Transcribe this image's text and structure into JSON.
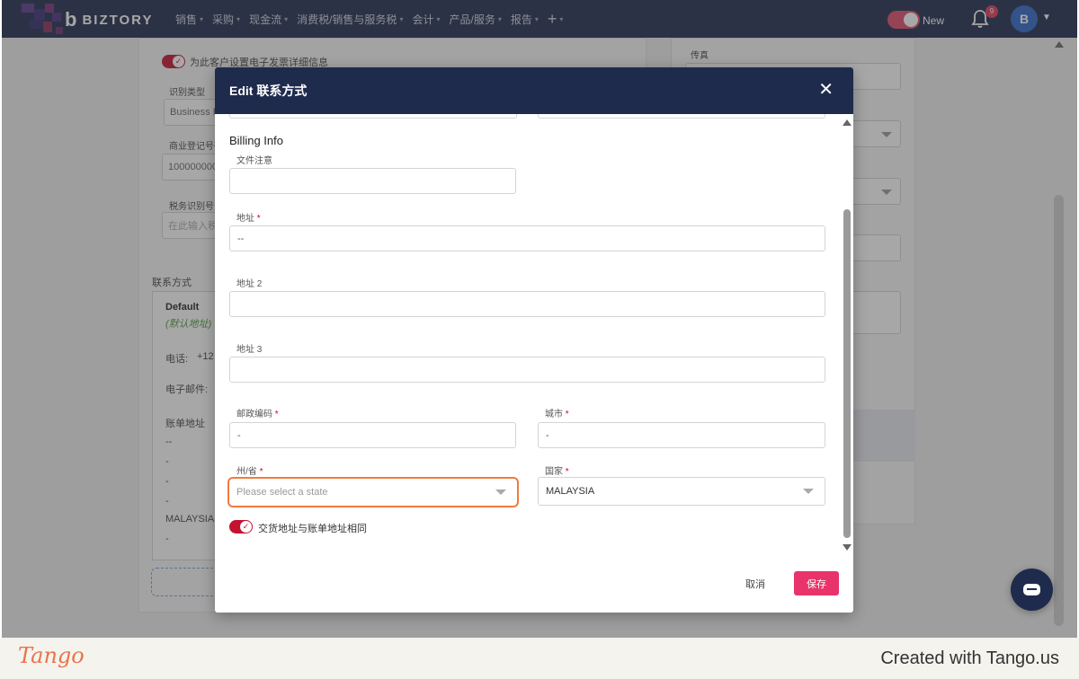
{
  "topnav": {
    "logo_text": "BIZTORY",
    "logo_mark": "b",
    "menu": [
      {
        "label": "销售"
      },
      {
        "label": "采购"
      },
      {
        "label": "现金流"
      },
      {
        "label": "消费税/销售与服务税"
      },
      {
        "label": "会计"
      },
      {
        "label": "产品/服务"
      },
      {
        "label": "报告"
      }
    ],
    "plus_label": "+",
    "new_label": "New",
    "notification_count": "9",
    "avatar_letter": "B",
    "brand_color": "#1f2b4d"
  },
  "background": {
    "einvoice_toggle_label": "为此客户设置电子发票详细信息",
    "id_type_label": "识别类型",
    "id_type_value": "Business R",
    "brn_label": "商业登记号码",
    "brn_value": "100000000",
    "tin_label": "税务识别号",
    "tin_placeholder": "在此输入税",
    "contacts_label": "联系方式",
    "contact_default": "Default",
    "contact_default_sub": "(默认地址)",
    "phone_label": "电话:",
    "phone_value": "+12",
    "email_label": "电子邮件:",
    "billing_label": "账单地址",
    "billing_lines": [
      "--",
      "-",
      "-",
      "-"
    ],
    "billing_country": "MALAYSIA",
    "billing_last": "-",
    "fax_label": "传真"
  },
  "modal": {
    "title": "Edit 联系方式",
    "close_icon": "close-icon",
    "section_title": "Billing Info",
    "doc_note_label": "文件注意",
    "doc_note_value": "",
    "address_label": "地址",
    "address_value": "--",
    "address2_label": "地址 2",
    "address2_value": "",
    "address3_label": "地址 3",
    "address3_value": "",
    "postcode_label": "邮政编码",
    "postcode_value": "-",
    "city_label": "城市",
    "city_value": "-",
    "state_label": "州/省",
    "state_placeholder": "Please select a state",
    "country_label": "国家",
    "country_value": "MALAYSIA",
    "same_address_label": "交货地址与账单地址相同",
    "required_mark": "*",
    "cancel_label": "取消",
    "save_label": "保存",
    "accent_color": "#e8346a",
    "focus_color": "#f07b3f"
  },
  "footer": {
    "tango_logo": "Tango",
    "created_with": "Created with Tango.us"
  }
}
